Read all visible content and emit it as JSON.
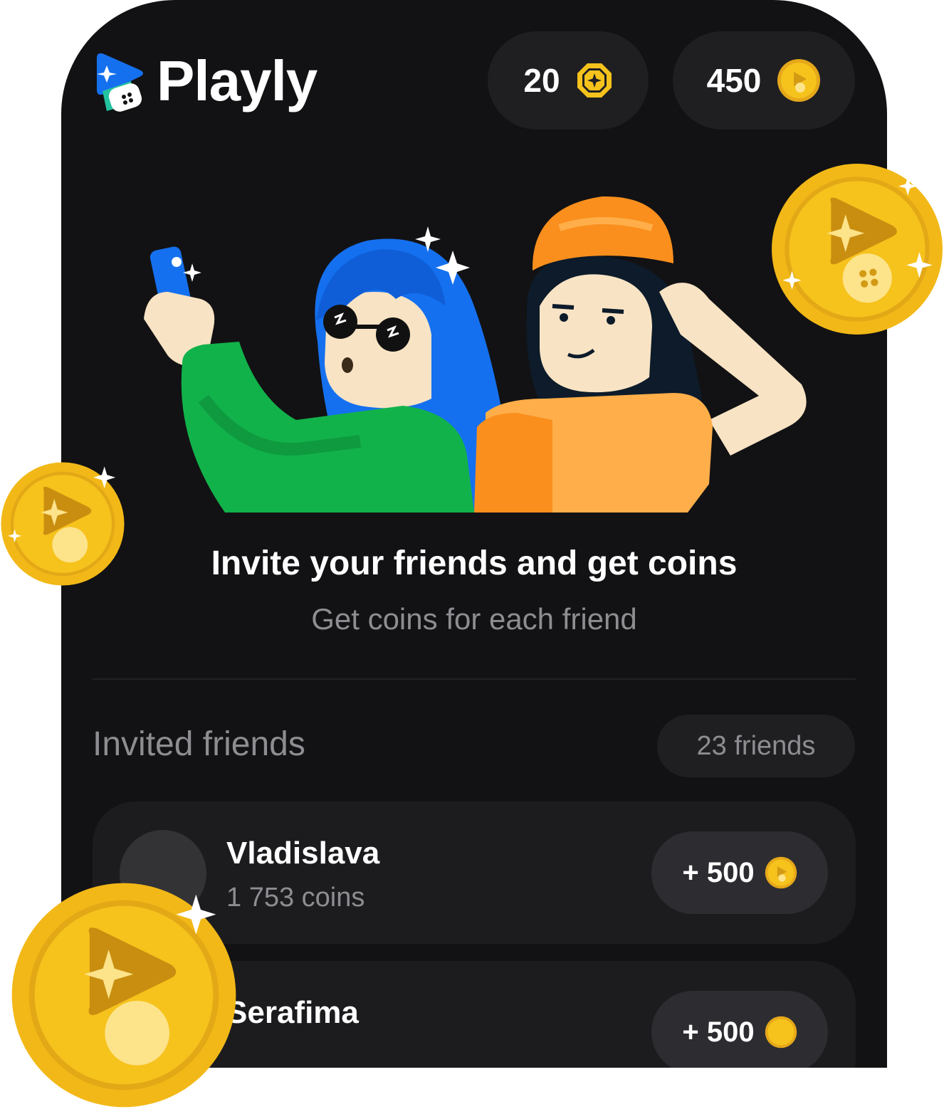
{
  "app": {
    "name": "Playly"
  },
  "balances": {
    "gems": "20",
    "coins": "450"
  },
  "promo": {
    "title": "Invite your friends and get coins",
    "subtitle": "Get coins for each friend"
  },
  "friends": {
    "section_title": "Invited friends",
    "count": "23 friends",
    "items": [
      {
        "name": "Vladislava",
        "coins": "1 753 coins",
        "reward": "+ 500"
      },
      {
        "name": "Serafima",
        "coins": "",
        "reward": "+ 500"
      }
    ]
  },
  "colors": {
    "background": "#121214",
    "card": "#1c1c1f",
    "pill": "#1f1f22",
    "coin": "#f6c21c",
    "accent_blue": "#1570ef"
  }
}
